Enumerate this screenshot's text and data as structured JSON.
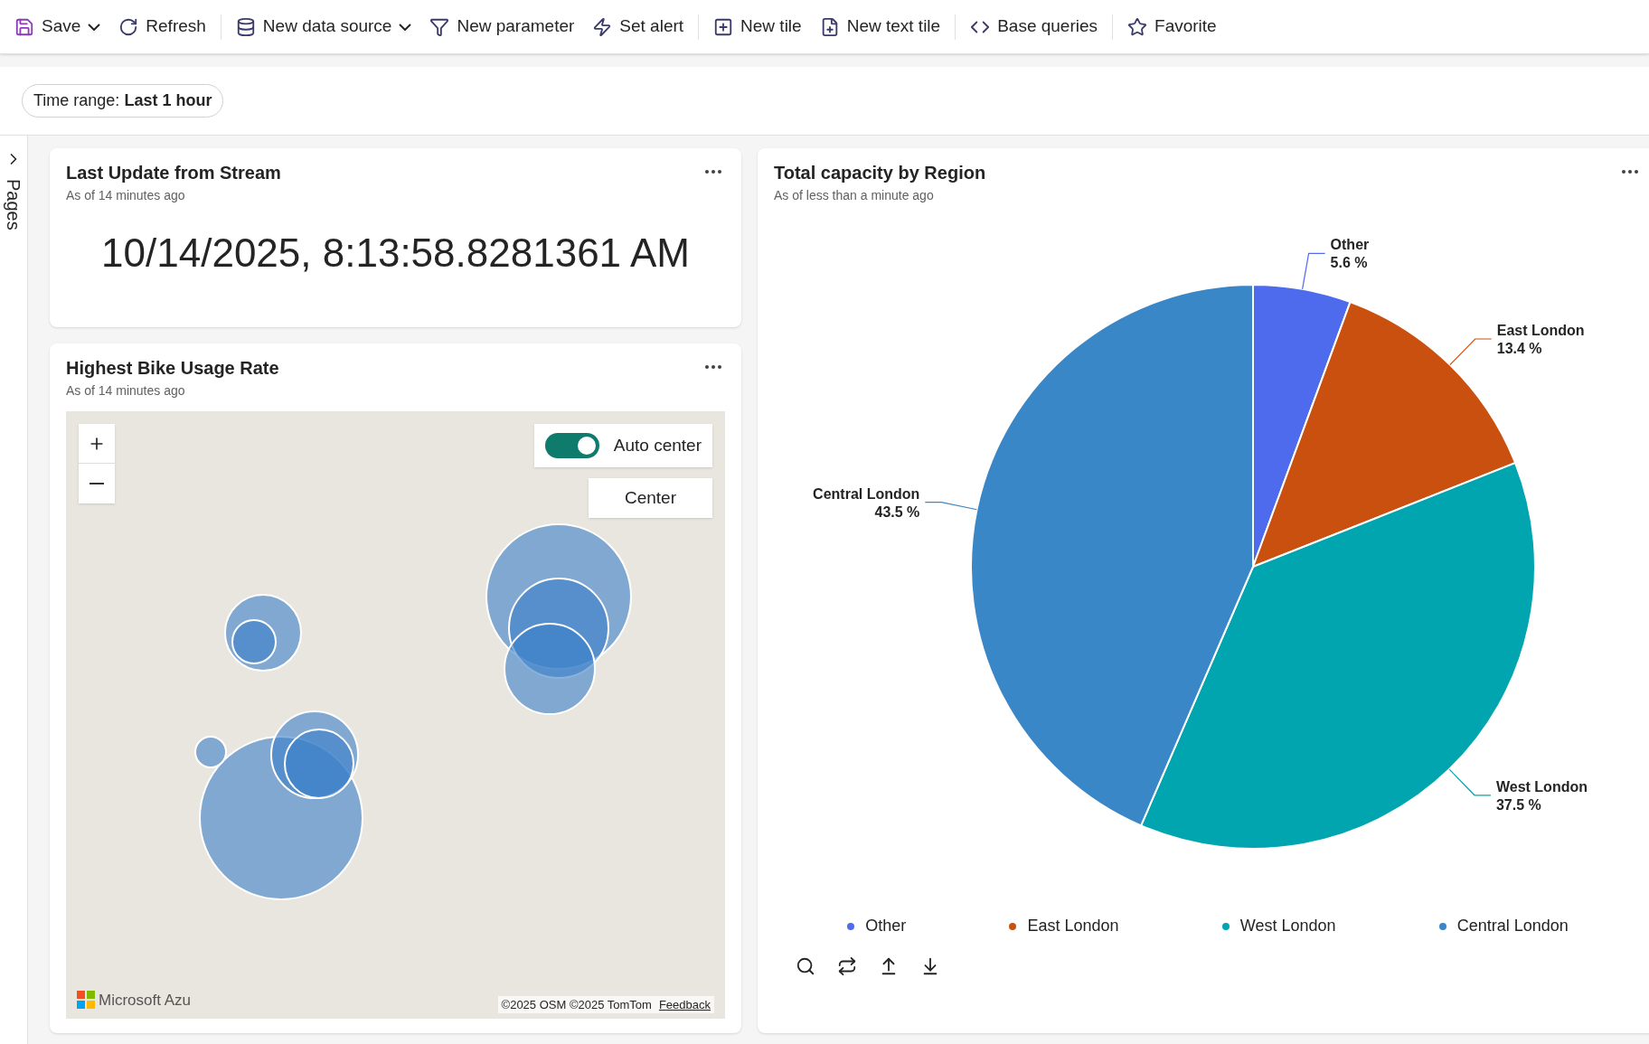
{
  "toolbar": [
    {
      "label": "Save",
      "kind": "dropdown"
    },
    {
      "label": "Refresh",
      "kind": "button"
    },
    {
      "label": "New data source",
      "kind": "dropdown"
    },
    {
      "label": "New parameter",
      "kind": "button"
    },
    {
      "label": "Set alert",
      "kind": "button"
    },
    {
      "label": "New tile",
      "kind": "button"
    },
    {
      "label": "New text tile",
      "kind": "button"
    },
    {
      "label": "Base queries",
      "kind": "button"
    },
    {
      "label": "Favorite",
      "kind": "button"
    }
  ],
  "time_range": {
    "label": "Time range:",
    "value": "Last 1 hour"
  },
  "pages_rail": {
    "label": "Pages"
  },
  "last_update": {
    "title": "Last Update from Stream",
    "subtitle": "As of 14 minutes ago",
    "value": "10/14/2025, 8:13:58.8281361 AM"
  },
  "bike_map": {
    "title": "Highest Bike Usage Rate",
    "subtitle": "As of 14 minutes ago",
    "auto_center": {
      "label": "Auto center",
      "on": true
    },
    "center_button": "Center",
    "logo_text": "Microsoft Azu",
    "attribution": "©2025 OSM ©2025 TomTom",
    "feedback": "Feedback"
  },
  "capacity": {
    "title": "Total capacity by Region",
    "subtitle": "As of less than a minute ago",
    "chart_data": {
      "type": "pie",
      "categories": [
        "Other",
        "East London",
        "West London",
        "Central London"
      ],
      "values": [
        5.6,
        13.4,
        37.5,
        43.5
      ],
      "value_labels": [
        "5.6 %",
        "13.4 %",
        "37.5 %",
        "43.5 %"
      ]
    },
    "legend": [
      {
        "label": "Other",
        "color": "#4f6bed"
      },
      {
        "label": "East London",
        "color": "#ca5010"
      },
      {
        "label": "West London",
        "color": "#00a5b0"
      },
      {
        "label": "Central London",
        "color": "#3a87c8"
      }
    ]
  }
}
